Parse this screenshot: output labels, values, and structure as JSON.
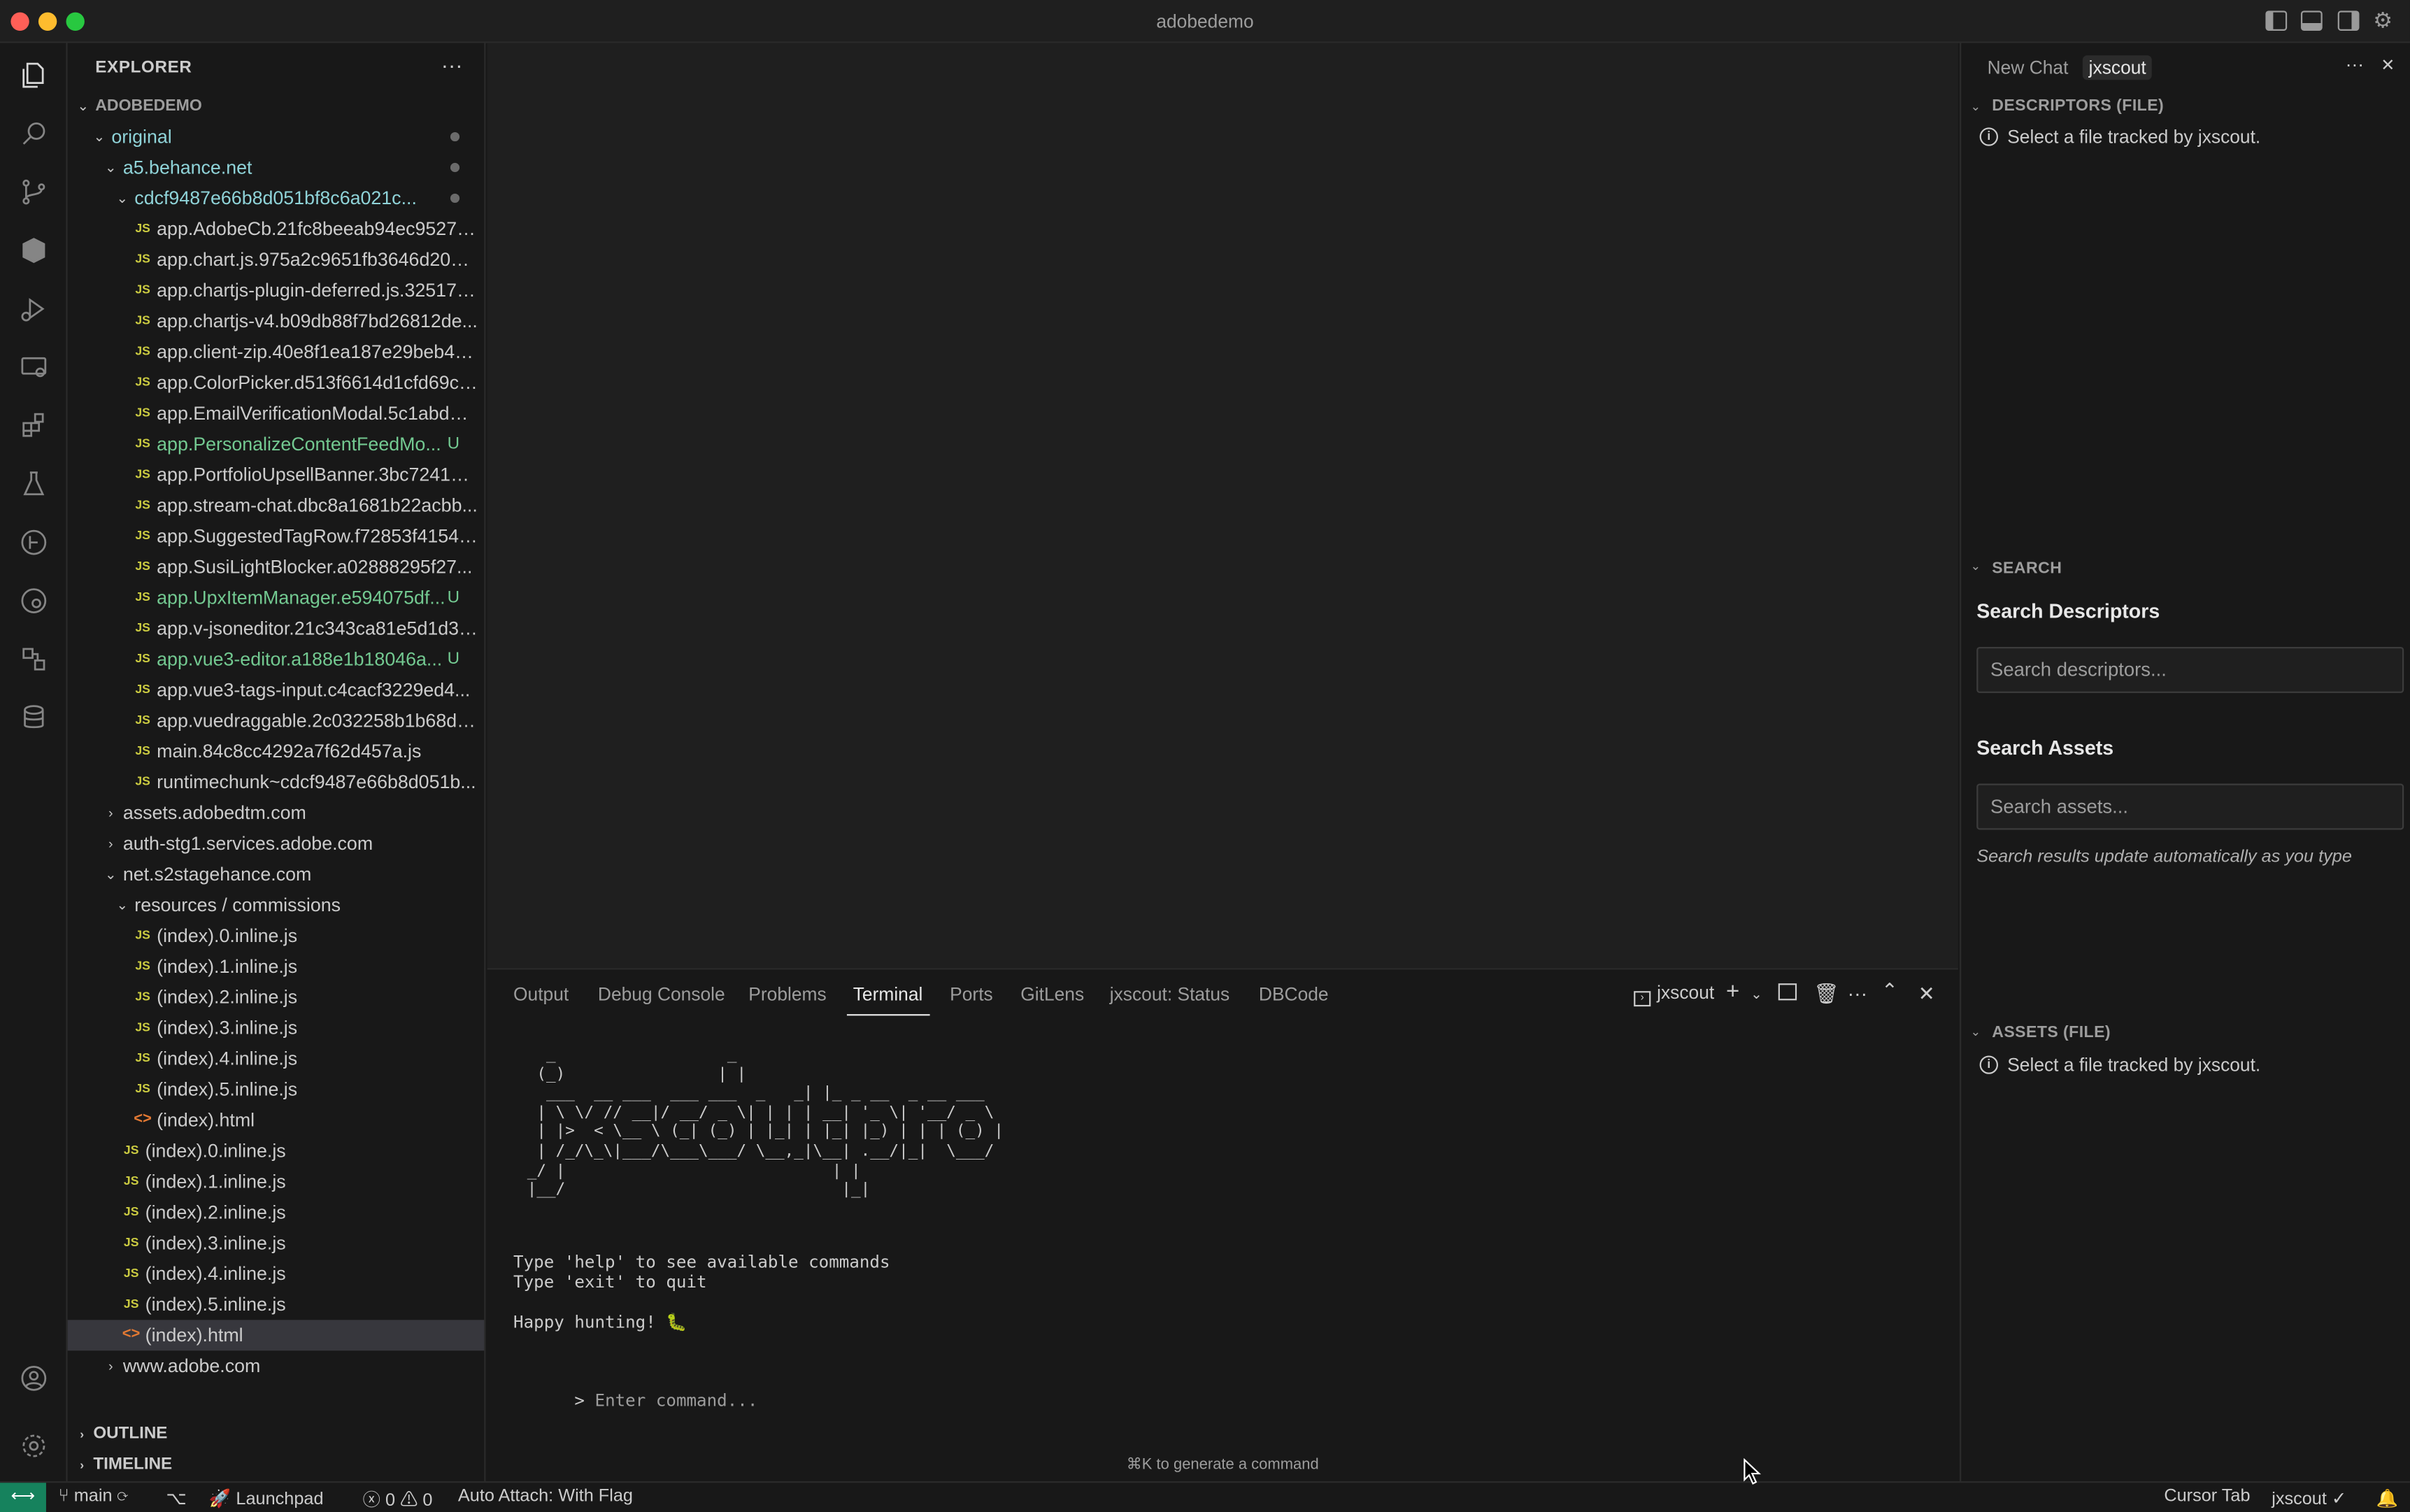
{
  "window": {
    "title": "adobedemo"
  },
  "explorer": {
    "header": "EXPLORER",
    "more": "···",
    "root": "ADOBEDEMO",
    "rows": [
      {
        "kind": "folder",
        "open": true,
        "depth": 1,
        "label": "original",
        "status": "folder-git",
        "dot": true
      },
      {
        "kind": "folder",
        "open": true,
        "depth": 2,
        "label": "a5.behance.net",
        "status": "folder-git",
        "dot": true
      },
      {
        "kind": "folder",
        "open": true,
        "depth": 3,
        "label": "cdcf9487e66b8d051bf8c6a021c...",
        "status": "folder-git",
        "dot": true
      },
      {
        "kind": "js",
        "depth": 4,
        "label": "app.AdobeCb.21fc8beeab94ec9527a..."
      },
      {
        "kind": "js",
        "depth": 4,
        "label": "app.chart.js.975a2c9651fb3646d20c.js"
      },
      {
        "kind": "js",
        "depth": 4,
        "label": "app.chartjs-plugin-deferred.js.32517a..."
      },
      {
        "kind": "js",
        "depth": 4,
        "label": "app.chartjs-v4.b09db88f7bd26812de..."
      },
      {
        "kind": "js",
        "depth": 4,
        "label": "app.client-zip.40e8f1ea187e29beb4d..."
      },
      {
        "kind": "js",
        "depth": 4,
        "label": "app.ColorPicker.d513f6614d1cfd69c6..."
      },
      {
        "kind": "js",
        "depth": 4,
        "label": "app.EmailVerificationModal.5c1abdd7..."
      },
      {
        "kind": "js",
        "depth": 4,
        "label": "app.PersonalizeContentFeedMo...",
        "status": "git",
        "badge": "U"
      },
      {
        "kind": "js",
        "depth": 4,
        "label": "app.PortfolioUpsellBanner.3bc72417e..."
      },
      {
        "kind": "js",
        "depth": 4,
        "label": "app.stream-chat.dbc8a1681b22acbb..."
      },
      {
        "kind": "js",
        "depth": 4,
        "label": "app.SuggestedTagRow.f72853f41548..."
      },
      {
        "kind": "js",
        "depth": 4,
        "label": "app.SusiLightBlocker.a02888295f27..."
      },
      {
        "kind": "js",
        "depth": 4,
        "label": "app.UpxItemManager.e594075df...",
        "status": "git",
        "badge": "U"
      },
      {
        "kind": "js",
        "depth": 4,
        "label": "app.v-jsoneditor.21c343ca81e5d1d3f..."
      },
      {
        "kind": "js",
        "depth": 4,
        "label": "app.vue3-editor.a188e1b18046a...",
        "status": "git",
        "badge": "U"
      },
      {
        "kind": "js",
        "depth": 4,
        "label": "app.vue3-tags-input.c4cacf3229ed4..."
      },
      {
        "kind": "js",
        "depth": 4,
        "label": "app.vuedraggable.2c032258b1b68d7..."
      },
      {
        "kind": "js",
        "depth": 4,
        "label": "main.84c8cc4292a7f62d457a.js"
      },
      {
        "kind": "js",
        "depth": 4,
        "label": "runtimechunk~cdcf9487e66b8d051b..."
      },
      {
        "kind": "folder",
        "open": false,
        "depth": 2,
        "label": "assets.adobedtm.com"
      },
      {
        "kind": "folder",
        "open": false,
        "depth": 2,
        "label": "auth-stg1.services.adobe.com"
      },
      {
        "kind": "folder",
        "open": true,
        "depth": 2,
        "label": "net.s2stagehance.com"
      },
      {
        "kind": "folder",
        "open": true,
        "depth": 3,
        "label": "resources / commissions"
      },
      {
        "kind": "js",
        "depth": 4,
        "label": "(index).0.inline.js"
      },
      {
        "kind": "js",
        "depth": 4,
        "label": "(index).1.inline.js"
      },
      {
        "kind": "js",
        "depth": 4,
        "label": "(index).2.inline.js"
      },
      {
        "kind": "js",
        "depth": 4,
        "label": "(index).3.inline.js"
      },
      {
        "kind": "js",
        "depth": 4,
        "label": "(index).4.inline.js"
      },
      {
        "kind": "js",
        "depth": 4,
        "label": "(index).5.inline.js"
      },
      {
        "kind": "html",
        "depth": 4,
        "label": "(index).html"
      },
      {
        "kind": "js",
        "depth": 3,
        "label": "(index).0.inline.js"
      },
      {
        "kind": "js",
        "depth": 3,
        "label": "(index).1.inline.js"
      },
      {
        "kind": "js",
        "depth": 3,
        "label": "(index).2.inline.js"
      },
      {
        "kind": "js",
        "depth": 3,
        "label": "(index).3.inline.js"
      },
      {
        "kind": "js",
        "depth": 3,
        "label": "(index).4.inline.js"
      },
      {
        "kind": "js",
        "depth": 3,
        "label": "(index).5.inline.js"
      },
      {
        "kind": "html",
        "depth": 3,
        "label": "(index).html",
        "selected": true
      },
      {
        "kind": "folder",
        "open": false,
        "depth": 2,
        "label": "www.adobe.com"
      }
    ],
    "outline": "OUTLINE",
    "timeline": "TIMELINE"
  },
  "panel": {
    "tabs": [
      "Output",
      "Debug Console",
      "Problems",
      "Terminal",
      "Ports",
      "GitLens",
      "jxscout: Status",
      "DBCode"
    ],
    "active_tab": "Terminal",
    "terminal_name": "jxscout",
    "ascii_art": "  _                  _\n (_)                | |\n  ___  __ ___  ___ ___  _   _| |_ _ __  _ __ ___\n | \\ \\/ // __|/ __/ _ \\| | | | __| '_ \\| '__/ _ \\\n | |>  < \\__ \\ (_| (_) | |_| | |_| |_) | | | (_) |\n | /_/\\_\\|___/\\___\\___/ \\__,_|\\__| .__/|_|  \\___/\n_/ |                            | |\n|__/                             |_|",
    "lines": [
      "Type 'help' to see available commands",
      "Type 'exit' to quit",
      "",
      "Happy hunting! 🐛"
    ],
    "prompt_symbol": ">",
    "prompt_placeholder": "Enter command...",
    "hint": "⌘K to generate a command"
  },
  "right": {
    "tabs": [
      "New Chat",
      "jxscout"
    ],
    "descriptors_header": "DESCRIPTORS (FILE)",
    "descriptors_info": "Select a file tracked by jxscout.",
    "search_header": "SEARCH",
    "search_descriptors_title": "Search Descriptors",
    "search_descriptors_placeholder": "Search descriptors...",
    "search_assets_title": "Search Assets",
    "search_assets_placeholder": "Search assets...",
    "search_note": "Search results update automatically as you type",
    "assets_header": "ASSETS (FILE)",
    "assets_info": "Select a file tracked by jxscout."
  },
  "status": {
    "branch": "main",
    "launchpad": "Launchpad",
    "errors": "0",
    "warnings": "0",
    "auto_attach": "Auto Attach: With Flag",
    "cursor_tab": "Cursor Tab",
    "jxscout": "jxscout ✓"
  }
}
